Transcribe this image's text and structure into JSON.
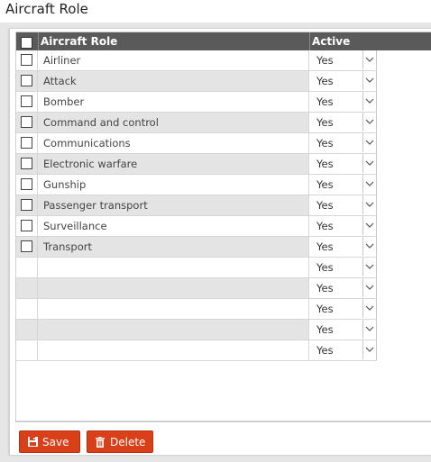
{
  "page": {
    "title": "Aircraft Role"
  },
  "grid": {
    "columns": {
      "role": "Aircraft Role",
      "active": "Active"
    },
    "rows": [
      {
        "role": "Airliner",
        "active": "Yes"
      },
      {
        "role": "Attack",
        "active": "Yes"
      },
      {
        "role": "Bomber",
        "active": "Yes"
      },
      {
        "role": "Command and control",
        "active": "Yes"
      },
      {
        "role": "Communications",
        "active": "Yes"
      },
      {
        "role": "Electronic warfare",
        "active": "Yes"
      },
      {
        "role": "Gunship",
        "active": "Yes"
      },
      {
        "role": "Passenger transport",
        "active": "Yes"
      },
      {
        "role": "Surveillance",
        "active": "Yes"
      },
      {
        "role": "Transport",
        "active": "Yes"
      },
      {
        "role": "",
        "active": "Yes"
      },
      {
        "role": "",
        "active": "Yes"
      },
      {
        "role": "",
        "active": "Yes"
      },
      {
        "role": "",
        "active": "Yes"
      },
      {
        "role": "",
        "active": "Yes"
      }
    ]
  },
  "buttons": {
    "save": "Save",
    "delete": "Delete"
  },
  "icons": {
    "save": "floppy-disk-icon",
    "delete": "trash-icon",
    "dropdown": "chevron-down-icon"
  },
  "colors": {
    "header_bg": "#5a5a5a",
    "button_bg": "#d9401a",
    "alt_row": "#e4e4e4"
  }
}
